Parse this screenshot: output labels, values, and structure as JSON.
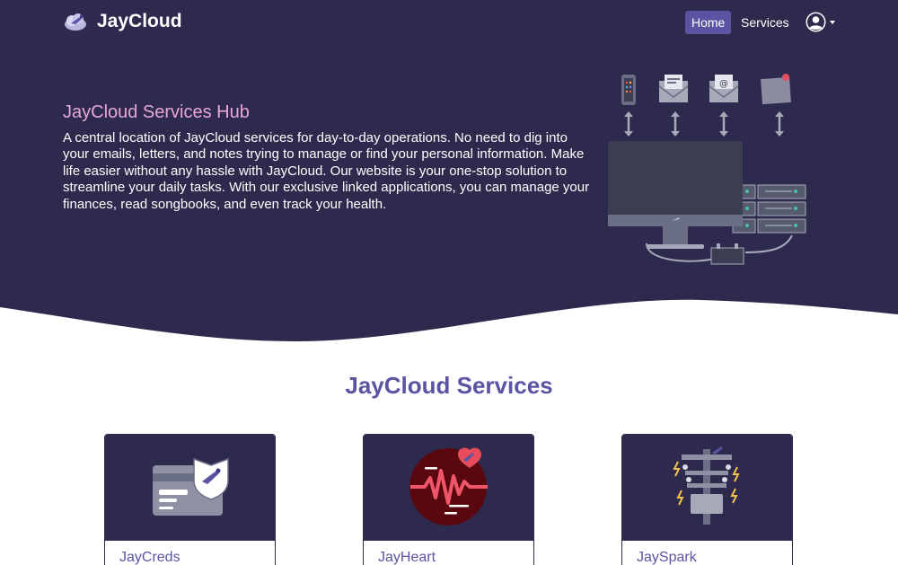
{
  "navbar": {
    "brand": "JayCloud",
    "home_label": "Home",
    "services_label": "Services"
  },
  "hero": {
    "title": "JayCloud Services Hub",
    "description": "A central location of JayCloud services for day-to-day operations. No need to dig into your emails, letters, and notes trying to manage or find your personal information. Make life easier without any hassle with JayCloud. Our website is your one-stop solution to streamline your daily tasks. With our exclusive linked applications, you can manage your finances, read songbooks, and even track your health."
  },
  "services": {
    "title": "JayCloud Services",
    "cards": [
      {
        "name": "JayCreds",
        "icon": "credit-card-shield-icon"
      },
      {
        "name": "JayHeart",
        "icon": "heartbeat-icon"
      },
      {
        "name": "JaySpark",
        "icon": "power-pole-icon"
      }
    ]
  },
  "colors": {
    "hero_bg": "#2d2a4e",
    "accent": "#5a54a3",
    "hero_title": "#e8a7d8"
  }
}
